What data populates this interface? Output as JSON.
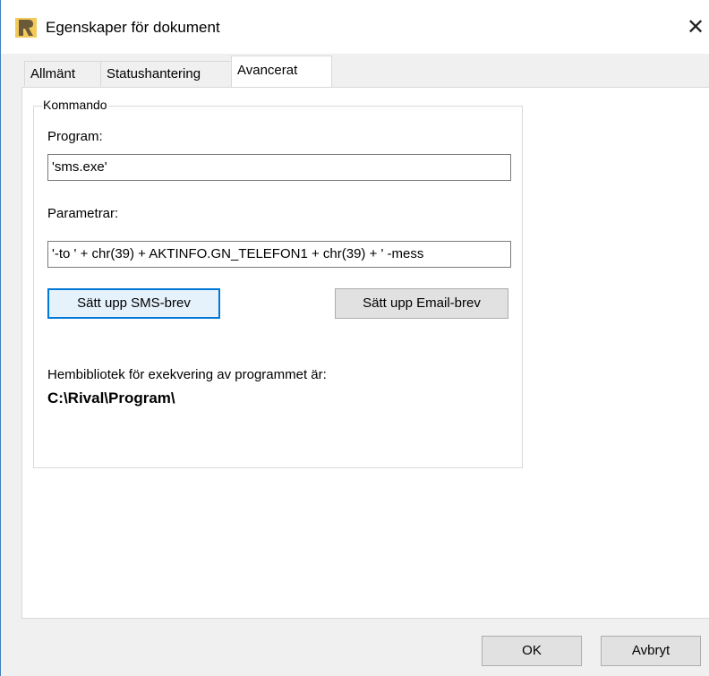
{
  "window": {
    "title": "Egenskaper för dokument",
    "close_symbol": "✕"
  },
  "tabs": [
    {
      "label": "Allmänt"
    },
    {
      "label": "Statushantering"
    },
    {
      "label": "Avancerat",
      "active": true
    }
  ],
  "command": {
    "group_label": "Kommando",
    "program_label": "Program:",
    "program_value": "'sms.exe'",
    "parameters_label": "Parametrar:",
    "parameters_value": "'-to ' + chr(39) + AKTINFO.GN_TELEFON1 + chr(39) + ' -mess",
    "sms_button": "Sätt upp SMS-brev",
    "email_button": "Sätt upp Email-brev",
    "home_dir_label": "Hembibliotek för exekvering av programmet är:",
    "home_dir_value": "C:\\Rival\\Program\\"
  },
  "footer": {
    "ok": "OK",
    "cancel": "Avbryt"
  },
  "colors": {
    "accent": "#0078d7",
    "panel": "#ffffff",
    "background": "#f0f0f0"
  }
}
